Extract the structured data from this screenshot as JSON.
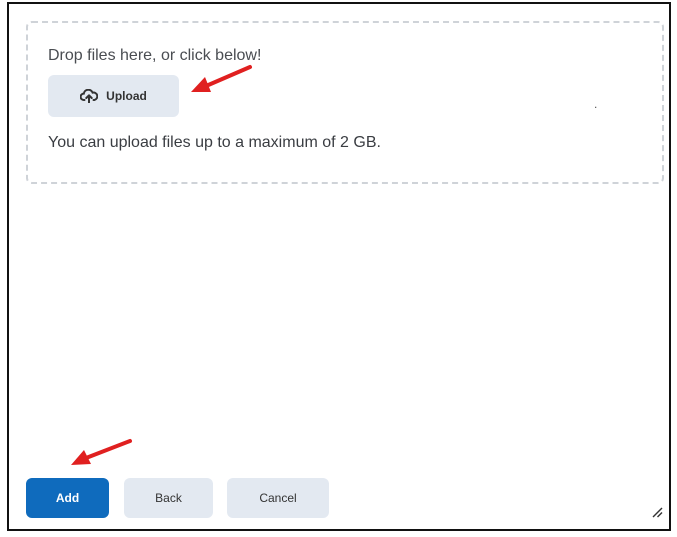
{
  "dropzone": {
    "instruction": "Drop files here, or click below!",
    "upload_label": "Upload",
    "upload_icon": "cloud-upload-icon",
    "limit_text": "You can upload files up to a maximum of 2 GB.",
    "stray_mark": "."
  },
  "footer": {
    "add_label": "Add",
    "back_label": "Back",
    "cancel_label": "Cancel"
  },
  "colors": {
    "primary": "#0f6bbd",
    "secondary_button": "#e3e9f1",
    "annotation_arrow": "#e02020",
    "dropzone_border": "#cfd3d8"
  }
}
